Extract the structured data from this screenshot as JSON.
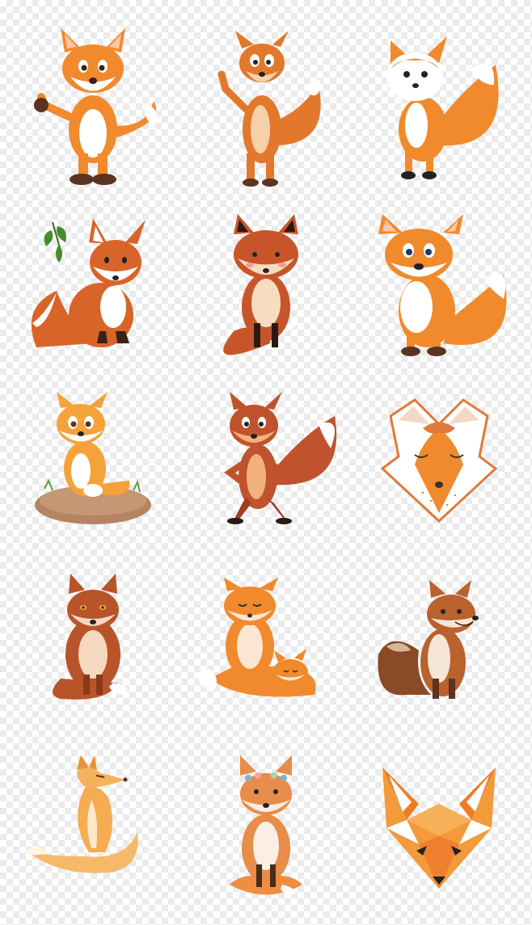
{
  "grid": {
    "rows": 5,
    "columns": 3
  },
  "palette": {
    "orange": "#f08a2c",
    "dark_orange": "#d9642a",
    "rust": "#b9542a",
    "white": "#ffffff",
    "brown": "#5b3320",
    "background_checker": "#ebebeb"
  },
  "illustrations": [
    "cartoon-fox-thumbs-up",
    "cartoon-fox-waving",
    "white-faced-fox-sitting",
    "fox-with-leaves",
    "fox-sitting-front",
    "smiling-fox-sitting",
    "fox-on-dirt-mound",
    "standing-fox-hands-on-hips",
    "decorative-fox-face",
    "fluffy-red-fox",
    "fox-mother-with-cub",
    "realistic-smiling-fox",
    "watercolor-fox-curled-tail",
    "watercolor-fox-with-flower-crown",
    "geometric-fox-head"
  ]
}
